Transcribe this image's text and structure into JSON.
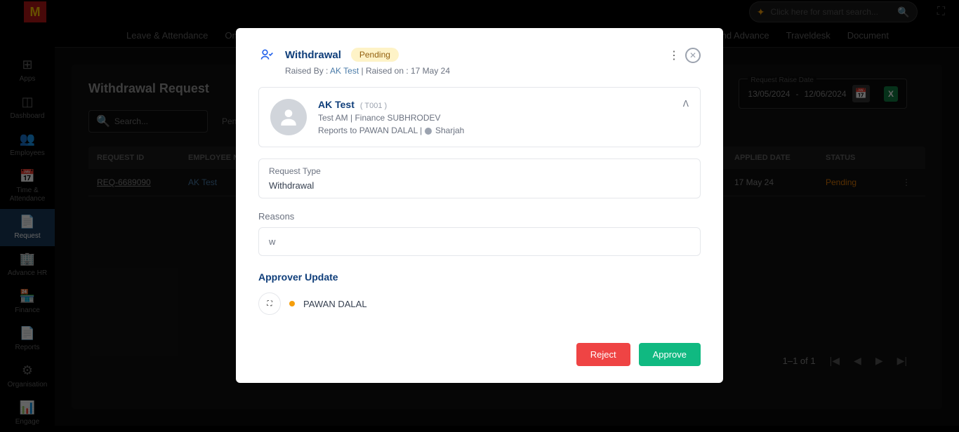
{
  "header": {
    "search_placeholder": "Click here for smart search...",
    "logo": "M"
  },
  "nav": {
    "items": [
      "Leave & Attendance",
      "Onboa",
      "oan And Advance",
      "Traveldesk",
      "Document"
    ]
  },
  "sidebar": {
    "items": [
      {
        "label": "Apps",
        "icon": "⊞"
      },
      {
        "label": "Dashboard",
        "icon": "◫"
      },
      {
        "label": "Employees",
        "icon": "👥"
      },
      {
        "label": "Time & Attendance",
        "icon": "📅"
      },
      {
        "label": "Request",
        "icon": "📄",
        "active": true
      },
      {
        "label": "Advance HR",
        "icon": "🏢"
      },
      {
        "label": "Finance",
        "icon": "🏪"
      },
      {
        "label": "Reports",
        "icon": "📄"
      },
      {
        "label": "Organisation",
        "icon": "⚙"
      },
      {
        "label": "Engage",
        "icon": "📊"
      }
    ]
  },
  "page": {
    "title": "Withdrawal Request",
    "search_placeholder": "Search...",
    "status_filter": "Pending",
    "date_range_label": "Request Raise Date",
    "date_from": "13/05/2024",
    "date_to": "12/06/2024",
    "date_sep": "-"
  },
  "table": {
    "headers": {
      "req": "REQUEST ID",
      "emp": "EMPLOYEE NAME",
      "applied": "APPLIED DATE",
      "status": "STATUS"
    },
    "rows": [
      {
        "req": "REQ-6689090",
        "emp": "AK Test",
        "applied": "17 May 24",
        "status": "Pending"
      }
    ]
  },
  "pagination": {
    "text": "1–1 of 1"
  },
  "modal": {
    "title": "Withdrawal",
    "badge": "Pending",
    "raised_by_label": "Raised By : ",
    "raised_by_name": "AK Test",
    "raised_on_label": " | Raised on : ",
    "raised_on_date": "17 May 24",
    "employee": {
      "name": "AK Test",
      "code": "( T001 )",
      "role": "Test AM  |  Finance SUBHRODEV",
      "reports_label": "Reports to ",
      "reports_to": "PAWAN DALAL",
      "location": "Sharjah"
    },
    "request_type_label": "Request Type",
    "request_type_value": "Withdrawal",
    "reasons_label": "Reasons",
    "reasons_value": "w",
    "approver_title": "Approver Update",
    "approver_name": "PAWAN DALAL",
    "reject_label": "Reject",
    "approve_label": "Approve"
  }
}
